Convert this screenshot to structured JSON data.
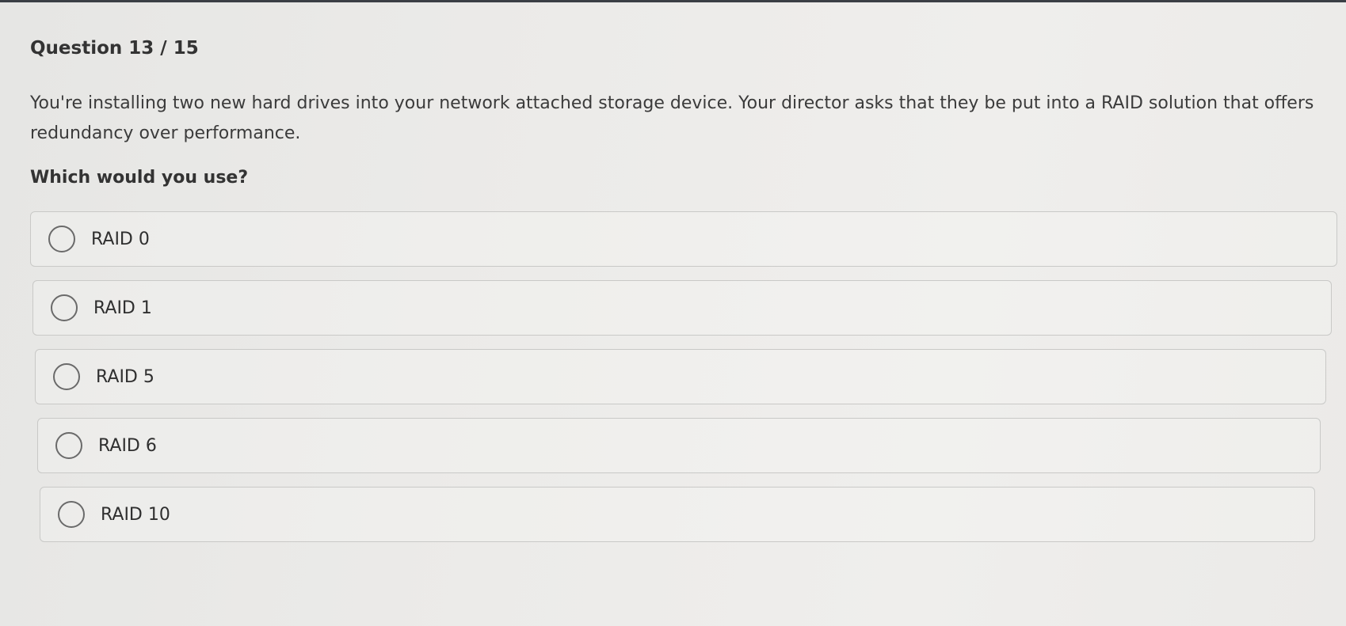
{
  "question": {
    "counter": "Question 13 / 15",
    "text": "You're installing two new hard drives into your network attached storage device. Your director asks that they be put into a RAID solution that offers redundancy over performance.",
    "prompt": "Which would you use?"
  },
  "options": [
    {
      "label": "RAID 0"
    },
    {
      "label": "RAID 1"
    },
    {
      "label": "RAID 5"
    },
    {
      "label": "RAID 6"
    },
    {
      "label": "RAID 10"
    }
  ],
  "colors": {
    "border": "#c9c9c7",
    "radio": "#6a6a6a",
    "text": "#3a3a3a"
  }
}
